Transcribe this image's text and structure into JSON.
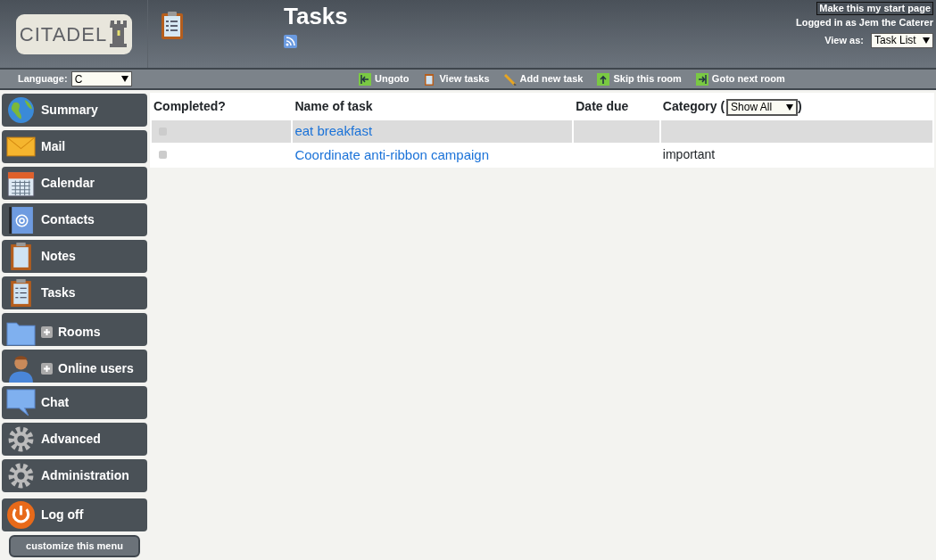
{
  "logo": {
    "text": "CITADEL"
  },
  "header": {
    "title": "Tasks",
    "start_page_button": "Make this my start page",
    "logged_in": "Logged in as Jem the Caterer",
    "view_as": {
      "label": "View as:",
      "value": "Task List"
    }
  },
  "language": {
    "label": "Language:",
    "value": "C"
  },
  "toolbar": [
    "Ungoto",
    "View tasks",
    "Add new task",
    "Skip this room",
    "Goto next room"
  ],
  "sidebar": {
    "items": [
      {
        "label": "Summary"
      },
      {
        "label": "Mail"
      },
      {
        "label": "Calendar"
      },
      {
        "label": "Contacts"
      },
      {
        "label": "Notes"
      },
      {
        "label": "Tasks"
      },
      {
        "label": "Rooms",
        "expanded": false
      },
      {
        "label": "Online users",
        "expanded": false
      },
      {
        "label": "Chat"
      },
      {
        "label": "Advanced"
      },
      {
        "label": "Administration"
      },
      {
        "label": "Log off"
      }
    ],
    "customize_button": "customize this menu"
  },
  "table": {
    "columns": [
      "Completed?",
      "Name of task",
      "Date due",
      "Category ("
    ],
    "category_filter": "Show All",
    "category_close": ")",
    "rows": [
      {
        "checked": false,
        "name": "eat breakfast",
        "date_due": "",
        "category": ""
      },
      {
        "checked": false,
        "name": "Coordinate anti-ribbon campaign",
        "date_due": "",
        "category": "important"
      }
    ]
  }
}
